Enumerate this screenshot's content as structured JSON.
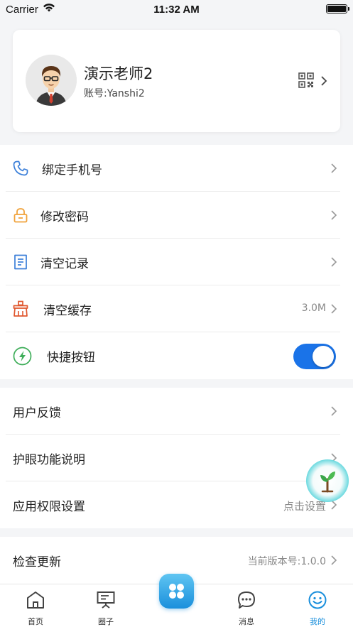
{
  "status_bar": {
    "carrier": "Carrier",
    "time": "11:32 AM"
  },
  "profile": {
    "name": "演示老师2",
    "account": "账号:Yanshi2",
    "icons": [
      "avatar",
      "qr-code-icon",
      "chevron-right-icon"
    ]
  },
  "settings_group_1": [
    {
      "label": "绑定手机号",
      "icon": "phone-icon",
      "icon_color": "#3b7fd9"
    },
    {
      "label": "修改密码",
      "icon": "lock-icon",
      "icon_color": "#f0a23b"
    },
    {
      "label": "清空记录",
      "icon": "document-icon",
      "icon_color": "#3b7fd9"
    },
    {
      "label": "清空缓存",
      "icon": "broom-icon",
      "icon_color": "#e0572e",
      "value": "3.0M"
    },
    {
      "label": "快捷按钮",
      "icon": "lightning-icon",
      "icon_color": "#3fae5a",
      "toggle_on": true
    }
  ],
  "settings_group_2": [
    {
      "label": "用户反馈"
    },
    {
      "label": "护眼功能说明"
    },
    {
      "label": "应用权限设置",
      "value": "点击设置"
    }
  ],
  "settings_group_3": [
    {
      "label": "检查更新",
      "value": "当前版本号:1.0.0"
    }
  ],
  "tab_bar": {
    "tabs": [
      {
        "label": "首页",
        "icon": "home-icon"
      },
      {
        "label": "圈子",
        "icon": "presentation-board-icon"
      },
      {
        "label": "消息",
        "icon": "chat-bubble-icon"
      },
      {
        "label": "我的",
        "icon": "smiley-face-icon",
        "active": true
      }
    ],
    "center_button_icon": "apps-grid-icon"
  },
  "colors": {
    "accent": "#1a73e8",
    "tab_active": "#1a8fdc",
    "background": "#f4f5f7"
  }
}
